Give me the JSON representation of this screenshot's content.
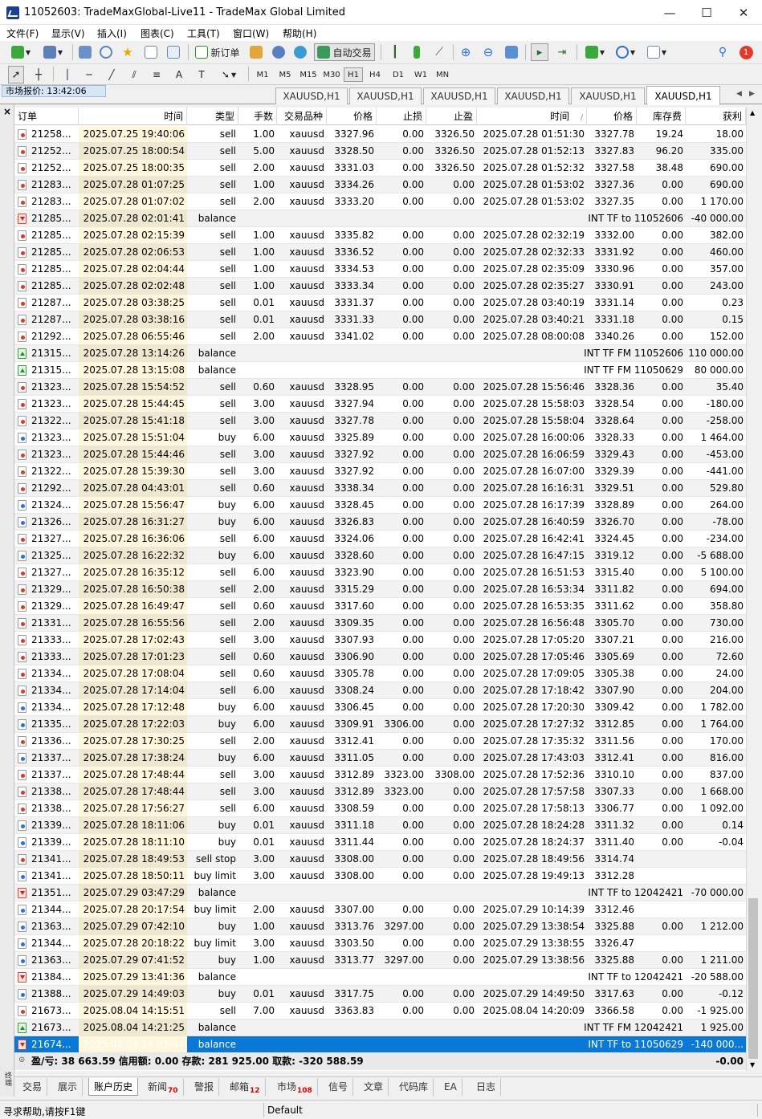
{
  "window": {
    "title": "11052603: TradeMaxGlobal-Live11 - TradeMax Global Limited",
    "minimize": "—",
    "maximize": "☐",
    "close": "✕"
  },
  "menu": [
    "文件(F)",
    "显示(V)",
    "插入(I)",
    "图表(C)",
    "工具(T)",
    "窗口(W)",
    "帮助(H)"
  ],
  "toolbar": {
    "new_order": "新订单",
    "auto_trading": "自动交易",
    "notification_count": "1"
  },
  "timeframes": [
    "M1",
    "M5",
    "M15",
    "M30",
    "H1",
    "H4",
    "D1",
    "W1",
    "MN"
  ],
  "active_timeframe": "H1",
  "market_watch_label": "市场报价: 13:42:06",
  "chart_tabs": [
    "XAUUSD,H1",
    "XAUUSD,H1",
    "XAUUSD,H1",
    "XAUUSD,H1",
    "XAUUSD,H1",
    "XAUUSD,H1"
  ],
  "active_chart_tab": 5,
  "panel_side_label": "终端",
  "columns": [
    "订单",
    "时间",
    "类型",
    "手数",
    "交易品种",
    "价格",
    "止损",
    "止盈",
    "时间",
    "价格",
    "库存费",
    "获利"
  ],
  "sort_indicator": "/",
  "rows": [
    [
      "21258...",
      "2025.07.25 19:40:06",
      "sell",
      "1.00",
      "xauusd",
      "3327.96",
      "0.00",
      "3326.50",
      "2025.07.28 01:51:30",
      "3327.78",
      "19.24",
      "18.00"
    ],
    [
      "21252...",
      "2025.07.25 18:00:54",
      "sell",
      "5.00",
      "xauusd",
      "3328.50",
      "0.00",
      "3326.50",
      "2025.07.28 01:52:13",
      "3327.83",
      "96.20",
      "335.00"
    ],
    [
      "21252...",
      "2025.07.25 18:00:35",
      "sell",
      "2.00",
      "xauusd",
      "3331.03",
      "0.00",
      "3326.50",
      "2025.07.28 01:52:32",
      "3327.58",
      "38.48",
      "690.00"
    ],
    [
      "21283...",
      "2025.07.28 01:07:25",
      "sell",
      "1.00",
      "xauusd",
      "3334.26",
      "0.00",
      "0.00",
      "2025.07.28 01:53:02",
      "3327.36",
      "0.00",
      "690.00"
    ],
    [
      "21283...",
      "2025.07.28 01:07:02",
      "sell",
      "2.00",
      "xauusd",
      "3333.20",
      "0.00",
      "0.00",
      "2025.07.28 01:53:02",
      "3327.35",
      "0.00",
      "1 170.00"
    ],
    [
      "21285...",
      "2025.07.28 02:01:41",
      "balance",
      "INT TF to 11052606",
      "-40 000.00"
    ],
    [
      "21285...",
      "2025.07.28 02:15:39",
      "sell",
      "1.00",
      "xauusd",
      "3335.82",
      "0.00",
      "0.00",
      "2025.07.28 02:32:19",
      "3332.00",
      "0.00",
      "382.00"
    ],
    [
      "21285...",
      "2025.07.28 02:06:53",
      "sell",
      "1.00",
      "xauusd",
      "3336.52",
      "0.00",
      "0.00",
      "2025.07.28 02:32:33",
      "3331.92",
      "0.00",
      "460.00"
    ],
    [
      "21285...",
      "2025.07.28 02:04:44",
      "sell",
      "1.00",
      "xauusd",
      "3334.53",
      "0.00",
      "0.00",
      "2025.07.28 02:35:09",
      "3330.96",
      "0.00",
      "357.00"
    ],
    [
      "21285...",
      "2025.07.28 02:02:48",
      "sell",
      "1.00",
      "xauusd",
      "3333.34",
      "0.00",
      "0.00",
      "2025.07.28 02:35:27",
      "3330.91",
      "0.00",
      "243.00"
    ],
    [
      "21287...",
      "2025.07.28 03:38:25",
      "sell",
      "0.01",
      "xauusd",
      "3331.37",
      "0.00",
      "0.00",
      "2025.07.28 03:40:19",
      "3331.14",
      "0.00",
      "0.23"
    ],
    [
      "21287...",
      "2025.07.28 03:38:16",
      "sell",
      "0.01",
      "xauusd",
      "3331.33",
      "0.00",
      "0.00",
      "2025.07.28 03:40:21",
      "3331.18",
      "0.00",
      "0.15"
    ],
    [
      "21292...",
      "2025.07.28 06:55:46",
      "sell",
      "2.00",
      "xauusd",
      "3341.02",
      "0.00",
      "0.00",
      "2025.07.28 08:00:08",
      "3340.26",
      "0.00",
      "152.00"
    ],
    [
      "21315...",
      "2025.07.28 13:14:26",
      "balance",
      "INT TF FM 11052606",
      "110 000.00"
    ],
    [
      "21315...",
      "2025.07.28 13:15:08",
      "balance",
      "INT TF FM 11050629",
      "80 000.00"
    ],
    [
      "21323...",
      "2025.07.28 15:54:52",
      "sell",
      "0.60",
      "xauusd",
      "3328.95",
      "0.00",
      "0.00",
      "2025.07.28 15:56:46",
      "3328.36",
      "0.00",
      "35.40"
    ],
    [
      "21323...",
      "2025.07.28 15:44:45",
      "sell",
      "3.00",
      "xauusd",
      "3327.94",
      "0.00",
      "0.00",
      "2025.07.28 15:58:03",
      "3328.54",
      "0.00",
      "-180.00"
    ],
    [
      "21322...",
      "2025.07.28 15:41:18",
      "sell",
      "3.00",
      "xauusd",
      "3327.78",
      "0.00",
      "0.00",
      "2025.07.28 15:58:04",
      "3328.64",
      "0.00",
      "-258.00"
    ],
    [
      "21323...",
      "2025.07.28 15:51:04",
      "buy",
      "6.00",
      "xauusd",
      "3325.89",
      "0.00",
      "0.00",
      "2025.07.28 16:00:06",
      "3328.33",
      "0.00",
      "1 464.00"
    ],
    [
      "21323...",
      "2025.07.28 15:44:46",
      "sell",
      "3.00",
      "xauusd",
      "3327.92",
      "0.00",
      "0.00",
      "2025.07.28 16:06:59",
      "3329.43",
      "0.00",
      "-453.00"
    ],
    [
      "21322...",
      "2025.07.28 15:39:30",
      "sell",
      "3.00",
      "xauusd",
      "3327.92",
      "0.00",
      "0.00",
      "2025.07.28 16:07:00",
      "3329.39",
      "0.00",
      "-441.00"
    ],
    [
      "21292...",
      "2025.07.28 04:43:01",
      "sell",
      "0.60",
      "xauusd",
      "3338.34",
      "0.00",
      "0.00",
      "2025.07.28 16:16:31",
      "3329.51",
      "0.00",
      "529.80"
    ],
    [
      "21324...",
      "2025.07.28 15:56:47",
      "buy",
      "6.00",
      "xauusd",
      "3328.45",
      "0.00",
      "0.00",
      "2025.07.28 16:17:39",
      "3328.89",
      "0.00",
      "264.00"
    ],
    [
      "21326...",
      "2025.07.28 16:31:27",
      "buy",
      "6.00",
      "xauusd",
      "3326.83",
      "0.00",
      "0.00",
      "2025.07.28 16:40:59",
      "3326.70",
      "0.00",
      "-78.00"
    ],
    [
      "21327...",
      "2025.07.28 16:36:06",
      "sell",
      "6.00",
      "xauusd",
      "3324.06",
      "0.00",
      "0.00",
      "2025.07.28 16:42:41",
      "3324.45",
      "0.00",
      "-234.00"
    ],
    [
      "21325...",
      "2025.07.28 16:22:32",
      "buy",
      "6.00",
      "xauusd",
      "3328.60",
      "0.00",
      "0.00",
      "2025.07.28 16:47:15",
      "3319.12",
      "0.00",
      "-5 688.00"
    ],
    [
      "21327...",
      "2025.07.28 16:35:12",
      "sell",
      "6.00",
      "xauusd",
      "3323.90",
      "0.00",
      "0.00",
      "2025.07.28 16:51:53",
      "3315.40",
      "0.00",
      "5 100.00"
    ],
    [
      "21329...",
      "2025.07.28 16:50:38",
      "sell",
      "2.00",
      "xauusd",
      "3315.29",
      "0.00",
      "0.00",
      "2025.07.28 16:53:34",
      "3311.82",
      "0.00",
      "694.00"
    ],
    [
      "21329...",
      "2025.07.28 16:49:47",
      "sell",
      "0.60",
      "xauusd",
      "3317.60",
      "0.00",
      "0.00",
      "2025.07.28 16:53:35",
      "3311.62",
      "0.00",
      "358.80"
    ],
    [
      "21331...",
      "2025.07.28 16:55:56",
      "sell",
      "2.00",
      "xauusd",
      "3309.35",
      "0.00",
      "0.00",
      "2025.07.28 16:56:48",
      "3305.70",
      "0.00",
      "730.00"
    ],
    [
      "21333...",
      "2025.07.28 17:02:43",
      "sell",
      "3.00",
      "xauusd",
      "3307.93",
      "0.00",
      "0.00",
      "2025.07.28 17:05:20",
      "3307.21",
      "0.00",
      "216.00"
    ],
    [
      "21333...",
      "2025.07.28 17:01:23",
      "sell",
      "0.60",
      "xauusd",
      "3306.90",
      "0.00",
      "0.00",
      "2025.07.28 17:05:46",
      "3305.69",
      "0.00",
      "72.60"
    ],
    [
      "21334...",
      "2025.07.28 17:08:04",
      "sell",
      "0.60",
      "xauusd",
      "3305.78",
      "0.00",
      "0.00",
      "2025.07.28 17:09:05",
      "3305.38",
      "0.00",
      "24.00"
    ],
    [
      "21334...",
      "2025.07.28 17:14:04",
      "sell",
      "6.00",
      "xauusd",
      "3308.24",
      "0.00",
      "0.00",
      "2025.07.28 17:18:42",
      "3307.90",
      "0.00",
      "204.00"
    ],
    [
      "21334...",
      "2025.07.28 17:12:48",
      "buy",
      "6.00",
      "xauusd",
      "3306.45",
      "0.00",
      "0.00",
      "2025.07.28 17:20:30",
      "3309.42",
      "0.00",
      "1 782.00"
    ],
    [
      "21335...",
      "2025.07.28 17:22:03",
      "buy",
      "6.00",
      "xauusd",
      "3309.91",
      "3306.00",
      "0.00",
      "2025.07.28 17:27:32",
      "3312.85",
      "0.00",
      "1 764.00"
    ],
    [
      "21336...",
      "2025.07.28 17:30:25",
      "sell",
      "2.00",
      "xauusd",
      "3312.41",
      "0.00",
      "0.00",
      "2025.07.28 17:35:32",
      "3311.56",
      "0.00",
      "170.00"
    ],
    [
      "21337...",
      "2025.07.28 17:38:24",
      "buy",
      "6.00",
      "xauusd",
      "3311.05",
      "0.00",
      "0.00",
      "2025.07.28 17:43:03",
      "3312.41",
      "0.00",
      "816.00"
    ],
    [
      "21337...",
      "2025.07.28 17:48:44",
      "sell",
      "3.00",
      "xauusd",
      "3312.89",
      "3323.00",
      "3308.00",
      "2025.07.28 17:52:36",
      "3310.10",
      "0.00",
      "837.00"
    ],
    [
      "21338...",
      "2025.07.28 17:48:44",
      "sell",
      "3.00",
      "xauusd",
      "3312.89",
      "3323.00",
      "0.00",
      "2025.07.28 17:57:58",
      "3307.33",
      "0.00",
      "1 668.00"
    ],
    [
      "21338...",
      "2025.07.28 17:56:27",
      "sell",
      "6.00",
      "xauusd",
      "3308.59",
      "0.00",
      "0.00",
      "2025.07.28 17:58:13",
      "3306.77",
      "0.00",
      "1 092.00"
    ],
    [
      "21339...",
      "2025.07.28 18:11:06",
      "buy",
      "0.01",
      "xauusd",
      "3311.18",
      "0.00",
      "0.00",
      "2025.07.28 18:24:28",
      "3311.32",
      "0.00",
      "0.14"
    ],
    [
      "21339...",
      "2025.07.28 18:11:10",
      "buy",
      "0.01",
      "xauusd",
      "3311.44",
      "0.00",
      "0.00",
      "2025.07.28 18:24:37",
      "3311.40",
      "0.00",
      "-0.04"
    ],
    [
      "21341...",
      "2025.07.28 18:49:53",
      "sell stop",
      "3.00",
      "xauusd",
      "3308.00",
      "0.00",
      "0.00",
      "2025.07.28 18:49:56",
      "3314.74",
      "",
      ""
    ],
    [
      "21341...",
      "2025.07.28 18:50:11",
      "buy limit",
      "3.00",
      "xauusd",
      "3308.00",
      "0.00",
      "0.00",
      "2025.07.28 19:49:13",
      "3312.28",
      "",
      ""
    ],
    [
      "21351...",
      "2025.07.29 03:47:29",
      "balance",
      "INT TF to 12042421",
      "-70 000.00"
    ],
    [
      "21344...",
      "2025.07.28 20:17:54",
      "buy limit",
      "2.00",
      "xauusd",
      "3307.00",
      "0.00",
      "0.00",
      "2025.07.29 10:14:39",
      "3312.46",
      "",
      ""
    ],
    [
      "21363...",
      "2025.07.29 07:42:10",
      "buy",
      "1.00",
      "xauusd",
      "3313.76",
      "3297.00",
      "0.00",
      "2025.07.29 13:38:54",
      "3325.88",
      "0.00",
      "1 212.00"
    ],
    [
      "21344...",
      "2025.07.28 20:18:22",
      "buy limit",
      "3.00",
      "xauusd",
      "3303.50",
      "0.00",
      "0.00",
      "2025.07.29 13:38:55",
      "3326.47",
      "",
      ""
    ],
    [
      "21363...",
      "2025.07.29 07:41:52",
      "buy",
      "1.00",
      "xauusd",
      "3313.77",
      "3297.00",
      "0.00",
      "2025.07.29 13:38:56",
      "3325.88",
      "0.00",
      "1 211.00"
    ],
    [
      "21384...",
      "2025.07.29 13:41:36",
      "balance",
      "INT TF to 12042421",
      "-20 588.00"
    ],
    [
      "21388...",
      "2025.07.29 14:49:03",
      "buy",
      "0.01",
      "xauusd",
      "3317.75",
      "0.00",
      "0.00",
      "2025.07.29 14:49:50",
      "3317.63",
      "0.00",
      "-0.12"
    ],
    [
      "21673...",
      "2025.08.04 14:15:51",
      "sell",
      "7.00",
      "xauusd",
      "3363.83",
      "0.00",
      "0.00",
      "2025.08.04 14:20:09",
      "3366.58",
      "0.00",
      "-1 925.00"
    ],
    [
      "21673...",
      "2025.08.04 14:21:25",
      "balance",
      "INT TF FM 12042421",
      "1 925.00"
    ],
    [
      "21674...",
      "2025.08.04 14:21:44",
      "balance",
      "INT TF to 11050629",
      "-140 000..."
    ]
  ],
  "selected_row": 54,
  "summary": {
    "text": "盈/亏: 38 663.59  信用额: 0.00  存款: 281 925.00  取款: -320 588.59",
    "total": "-0.00"
  },
  "bottom_tabs": [
    {
      "label": "交易",
      "badge": ""
    },
    {
      "label": "展示",
      "badge": ""
    },
    {
      "label": "账户历史",
      "badge": ""
    },
    {
      "label": "新闻",
      "badge": "70"
    },
    {
      "label": "警报",
      "badge": ""
    },
    {
      "label": "邮箱",
      "badge": "12"
    },
    {
      "label": "市场",
      "badge": "108"
    },
    {
      "label": "信号",
      "badge": ""
    },
    {
      "label": "文章",
      "badge": ""
    },
    {
      "label": "代码库",
      "badge": ""
    },
    {
      "label": "EA",
      "badge": ""
    },
    {
      "label": "日志",
      "badge": ""
    }
  ],
  "active_bottom_tab": 2,
  "status": {
    "help": "寻求帮助,请按F1键",
    "profile": "Default"
  }
}
